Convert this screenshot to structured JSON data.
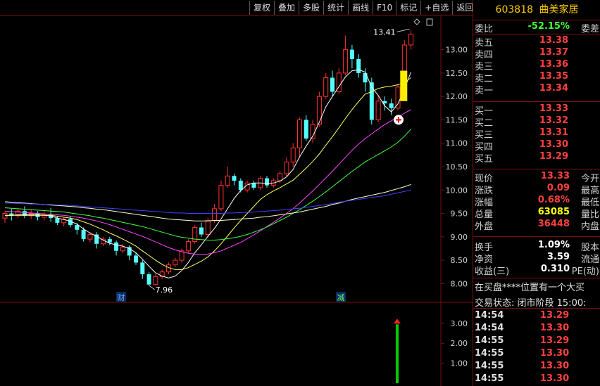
{
  "toolbar": {
    "buttons": [
      "复权",
      "叠加",
      "多股",
      "统计",
      "画线",
      "F10",
      "标记",
      "+自选",
      "返回"
    ]
  },
  "stock": {
    "code": "603818",
    "name": "曲美家居"
  },
  "quote": {
    "weibi_label": "委比",
    "weibi_value": "-52.15%",
    "weicha_label": "委差",
    "sell": [
      {
        "label": "卖五",
        "price": "13.38"
      },
      {
        "label": "卖四",
        "price": "13.37"
      },
      {
        "label": "卖三",
        "price": "13.36"
      },
      {
        "label": "卖二",
        "price": "13.35"
      },
      {
        "label": "卖一",
        "price": "13.34"
      }
    ],
    "buy": [
      {
        "label": "买一",
        "price": "13.33"
      },
      {
        "label": "买二",
        "price": "13.32"
      },
      {
        "label": "买三",
        "price": "13.31"
      },
      {
        "label": "买四",
        "price": "13.30"
      },
      {
        "label": "买五",
        "price": "13.29"
      }
    ],
    "stats": [
      {
        "label": "现价",
        "value": "13.33",
        "label2": "今开"
      },
      {
        "label": "涨跌",
        "value": "0.09",
        "label2": "最高"
      },
      {
        "label": "涨幅",
        "value": "0.68%",
        "label2": "最低"
      },
      {
        "label": "总量",
        "value": "63085",
        "label2": "量比"
      },
      {
        "label": "外盘",
        "value": "36448",
        "label2": "内盘"
      }
    ],
    "finance": [
      {
        "label": "换手",
        "value": "1.09%",
        "label2": "股本"
      },
      {
        "label": "净资",
        "value": "3.59",
        "label2": "流通"
      },
      {
        "label": "收益(三)",
        "value": "0.310",
        "label2": "PE(动)"
      }
    ],
    "notice": "在买盘****位置有一个大买",
    "trade_status": "交易状态: 闭市阶段 15:00:",
    "ticks": [
      {
        "time": "14:54",
        "price": "13.29"
      },
      {
        "time": "14:54",
        "price": "13.30"
      },
      {
        "time": "14:55",
        "price": "13.29"
      },
      {
        "time": "14:55",
        "price": "13.30"
      },
      {
        "time": "14:55",
        "price": "13.30"
      },
      {
        "time": "14:55",
        "price": "13.30"
      }
    ]
  },
  "chart_data": {
    "type": "candlestick",
    "price_axis": {
      "ticks": [
        "13.00",
        "12.50",
        "12.00",
        "11.50",
        "11.00",
        "10.50",
        "10.00",
        "9.50",
        "9.00",
        "8.50",
        "8.00"
      ],
      "ylim": [
        7.75,
        13.55
      ]
    },
    "volume_axis": {
      "ticks": [
        "3.00",
        "2.00",
        "1.00"
      ],
      "ylim": [
        0,
        3.7
      ]
    },
    "high_label": "13.41",
    "low_label": "7.96",
    "markers": [
      "财",
      "减"
    ],
    "colors": {
      "up": "#ff3232",
      "down": "#54ffff",
      "ma5": "#ffffff",
      "ma10": "#ffff66",
      "ma20": "#ff44ff",
      "ma30": "#44ff44",
      "ma60": "#ffffcc",
      "ma120": "#4040ff",
      "volume": "#00cc00"
    },
    "candles": [
      [
        9.4,
        9.5,
        9.55,
        9.3
      ],
      [
        9.5,
        9.45,
        9.6,
        9.35
      ],
      [
        9.45,
        9.55,
        9.6,
        9.4
      ],
      [
        9.55,
        9.45,
        9.65,
        9.4
      ],
      [
        9.45,
        9.5,
        9.58,
        9.38
      ],
      [
        9.5,
        9.42,
        9.55,
        9.35
      ],
      [
        9.42,
        9.48,
        9.55,
        9.35
      ],
      [
        9.48,
        9.4,
        9.62,
        9.32
      ],
      [
        9.4,
        9.3,
        9.45,
        9.25
      ],
      [
        9.3,
        9.38,
        9.42,
        9.22
      ],
      [
        9.38,
        9.25,
        9.45,
        9.2
      ],
      [
        9.25,
        9.15,
        9.3,
        9.05
      ],
      [
        9.15,
        8.95,
        9.2,
        8.9
      ],
      [
        8.95,
        9.05,
        9.1,
        8.88
      ],
      [
        9.05,
        8.85,
        9.1,
        8.75
      ],
      [
        8.85,
        8.95,
        9.0,
        8.8
      ],
      [
        8.95,
        8.88,
        9.0,
        8.82
      ],
      [
        8.88,
        8.7,
        8.92,
        8.6
      ],
      [
        8.7,
        8.78,
        8.85,
        8.65
      ],
      [
        8.78,
        8.6,
        8.82,
        8.5
      ],
      [
        8.6,
        8.45,
        8.65,
        8.4
      ],
      [
        8.45,
        8.2,
        8.5,
        8.1
      ],
      [
        8.2,
        7.98,
        8.25,
        7.96
      ],
      [
        7.98,
        8.15,
        8.2,
        7.96
      ],
      [
        8.15,
        8.25,
        8.3,
        8.1
      ],
      [
        8.25,
        8.4,
        8.45,
        8.2
      ],
      [
        8.4,
        8.5,
        8.55,
        8.35
      ],
      [
        8.5,
        8.7,
        8.75,
        8.45
      ],
      [
        8.7,
        8.9,
        8.95,
        8.65
      ],
      [
        8.9,
        9.2,
        9.25,
        8.85
      ],
      [
        9.2,
        9.05,
        9.3,
        9.0
      ],
      [
        9.05,
        9.35,
        9.4,
        9.0
      ],
      [
        9.35,
        9.6,
        9.7,
        9.3
      ],
      [
        9.6,
        10.1,
        10.2,
        9.55
      ],
      [
        10.1,
        10.3,
        10.5,
        10.05
      ],
      [
        10.3,
        10.2,
        10.35,
        10.1
      ],
      [
        10.2,
        10.0,
        10.25,
        9.95
      ],
      [
        10.0,
        10.15,
        10.2,
        9.95
      ],
      [
        10.15,
        10.05,
        10.2,
        10.0
      ],
      [
        10.05,
        10.25,
        10.3,
        10.0
      ],
      [
        10.25,
        10.1,
        10.3,
        10.05
      ],
      [
        10.1,
        10.2,
        10.25,
        10.05
      ],
      [
        10.2,
        10.35,
        10.4,
        10.15
      ],
      [
        10.35,
        10.6,
        10.7,
        10.3
      ],
      [
        10.6,
        10.9,
        11.0,
        10.5
      ],
      [
        10.9,
        11.5,
        11.55,
        10.7
      ],
      [
        11.5,
        11.1,
        11.6,
        11.05
      ],
      [
        11.1,
        11.4,
        11.5,
        11.0
      ],
      [
        11.4,
        12.0,
        12.1,
        11.35
      ],
      [
        12.0,
        12.4,
        12.5,
        11.95
      ],
      [
        12.4,
        12.1,
        12.55,
        12.0
      ],
      [
        12.1,
        12.5,
        12.6,
        12.05
      ],
      [
        12.5,
        13.0,
        13.3,
        12.45
      ],
      [
        13.0,
        12.8,
        13.1,
        12.6
      ],
      [
        12.8,
        12.5,
        12.9,
        12.4
      ],
      [
        12.5,
        12.3,
        12.6,
        12.1
      ],
      [
        12.3,
        11.5,
        12.4,
        11.4
      ],
      [
        11.5,
        11.9,
        12.0,
        11.45
      ],
      [
        11.9,
        11.85,
        12.0,
        11.7
      ],
      [
        11.85,
        11.75,
        11.95,
        11.6
      ],
      [
        11.75,
        12.2,
        12.25,
        11.7
      ],
      [
        12.2,
        13.1,
        13.2,
        12.15
      ],
      [
        13.1,
        13.33,
        13.41,
        13.0
      ]
    ],
    "ma_series": {
      "ma5": [
        9.45,
        9.46,
        9.47,
        9.47,
        9.48,
        9.47,
        9.46,
        9.45,
        9.4,
        9.37,
        9.33,
        9.27,
        9.17,
        9.08,
        9.01,
        8.93,
        8.86,
        8.83,
        8.8,
        8.75,
        8.66,
        8.52,
        8.37,
        8.23,
        8.16,
        8.12,
        8.16,
        8.28,
        8.45,
        8.66,
        8.83,
        9.01,
        9.18,
        9.38,
        9.6,
        9.82,
        9.99,
        10.11,
        10.15,
        10.15,
        10.14,
        10.15,
        10.19,
        10.28,
        10.44,
        10.71,
        10.94,
        11.15,
        11.45,
        11.78,
        12.0,
        12.21,
        12.42,
        12.55,
        12.57,
        12.52,
        12.2,
        12.02,
        11.8,
        11.67,
        11.84,
        12.16,
        12.52
      ],
      "ma10": [
        9.46,
        9.46,
        9.46,
        9.46,
        9.46,
        9.46,
        9.46,
        9.46,
        9.44,
        9.42,
        9.4,
        9.37,
        9.32,
        9.27,
        9.21,
        9.15,
        9.08,
        9.02,
        8.95,
        8.88,
        8.8,
        8.7,
        8.6,
        8.5,
        8.41,
        8.34,
        8.3,
        8.3,
        8.34,
        8.41,
        8.48,
        8.57,
        8.7,
        8.85,
        9.02,
        9.19,
        9.35,
        9.5,
        9.65,
        9.8,
        9.9,
        9.98,
        10.05,
        10.13,
        10.21,
        10.34,
        10.47,
        10.61,
        10.77,
        10.96,
        11.14,
        11.33,
        11.53,
        11.72,
        11.89,
        12.05,
        12.1,
        12.17,
        12.2,
        12.22,
        12.25,
        12.3,
        12.4
      ],
      "ma20": [
        9.55,
        9.54,
        9.53,
        9.52,
        9.51,
        9.5,
        9.49,
        9.48,
        9.47,
        9.46,
        9.44,
        9.42,
        9.4,
        9.37,
        9.34,
        9.3,
        9.26,
        9.21,
        9.16,
        9.11,
        9.06,
        9.01,
        8.95,
        8.89,
        8.83,
        8.77,
        8.72,
        8.68,
        8.65,
        8.63,
        8.62,
        8.63,
        8.66,
        8.7,
        8.76,
        8.82,
        8.88,
        8.96,
        9.04,
        9.13,
        9.22,
        9.31,
        9.4,
        9.5,
        9.6,
        9.72,
        9.85,
        9.98,
        10.12,
        10.26,
        10.4,
        10.55,
        10.7,
        10.85,
        10.98,
        11.1,
        11.2,
        11.3,
        11.4,
        11.48,
        11.56,
        11.64,
        11.72
      ],
      "ma30": [
        9.62,
        9.61,
        9.6,
        9.59,
        9.58,
        9.57,
        9.56,
        9.55,
        9.54,
        9.53,
        9.51,
        9.49,
        9.47,
        9.45,
        9.42,
        9.4,
        9.37,
        9.34,
        9.31,
        9.28,
        9.25,
        9.22,
        9.18,
        9.14,
        9.1,
        9.06,
        9.02,
        8.99,
        8.97,
        8.95,
        8.94,
        8.93,
        8.93,
        8.94,
        8.96,
        8.98,
        9.01,
        9.05,
        9.1,
        9.15,
        9.21,
        9.28,
        9.35,
        9.42,
        9.5,
        9.58,
        9.67,
        9.76,
        9.86,
        9.96,
        10.07,
        10.18,
        10.29,
        10.4,
        10.5,
        10.6,
        10.68,
        10.76,
        10.84,
        10.92,
        11.02,
        11.15,
        11.3
      ],
      "ma60": [
        9.75,
        9.74,
        9.73,
        9.72,
        9.71,
        9.7,
        9.69,
        9.68,
        9.67,
        9.66,
        9.65,
        9.64,
        9.62,
        9.61,
        9.59,
        9.58,
        9.56,
        9.54,
        9.52,
        9.5,
        9.48,
        9.46,
        9.44,
        9.42,
        9.4,
        9.38,
        9.37,
        9.36,
        9.35,
        9.34,
        9.34,
        9.34,
        9.35,
        9.35,
        9.36,
        9.37,
        9.38,
        9.39,
        9.4,
        9.42,
        9.43,
        9.45,
        9.47,
        9.49,
        9.51,
        9.53,
        9.56,
        9.59,
        9.62,
        9.65,
        9.69,
        9.72,
        9.76,
        9.8,
        9.83,
        9.86,
        9.89,
        9.92,
        9.95,
        9.99,
        10.03,
        10.07,
        10.12
      ],
      "ma120": [
        9.72,
        9.72,
        9.71,
        9.71,
        9.7,
        9.7,
        9.69,
        9.69,
        9.68,
        9.68,
        9.67,
        9.66,
        9.65,
        9.64,
        9.63,
        9.62,
        9.61,
        9.6,
        9.59,
        9.58,
        9.57,
        9.56,
        9.55,
        9.54,
        9.53,
        9.52,
        9.51,
        9.51,
        9.5,
        9.5,
        9.5,
        9.5,
        9.5,
        9.5,
        9.51,
        9.51,
        9.52,
        9.52,
        9.53,
        9.54,
        9.55,
        9.56,
        9.57,
        9.58,
        9.6,
        9.61,
        9.63,
        9.65,
        9.67,
        9.69,
        9.71,
        9.74,
        9.76,
        9.78,
        9.8,
        9.82,
        9.84,
        9.86,
        9.88,
        9.91,
        9.94,
        9.97,
        10.0
      ]
    },
    "volume_last": 2.95
  }
}
